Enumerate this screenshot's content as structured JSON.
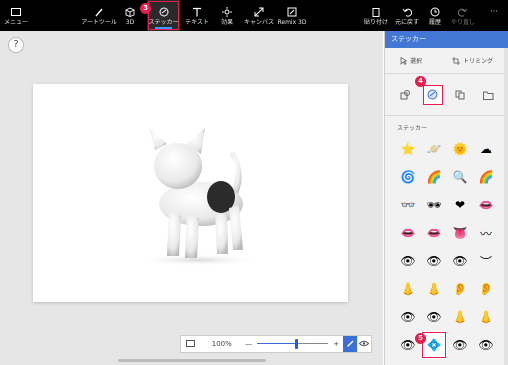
{
  "toolbar": {
    "menu": "メニュー",
    "items": [
      "アートツール",
      "3D",
      "ステッカー",
      "テキスト",
      "効果",
      "キャンバス",
      "Remix 3D"
    ],
    "right": [
      "貼り付け",
      "元に戻す",
      "履歴",
      "やり直し"
    ],
    "more": "···"
  },
  "callouts": {
    "c3": "3",
    "c4": "4",
    "c5": "5"
  },
  "help": "?",
  "zoom": {
    "level": "100%",
    "minus": "—",
    "plus": "+",
    "fraction": 0.55
  },
  "panel": {
    "title": "ステッカー",
    "select": "選択",
    "trim": "トリミング",
    "section": "ステッカー",
    "stickers": [
      [
        "⭐",
        "🪐",
        "🌞",
        "☁"
      ],
      [
        "🌀",
        "🌈",
        "🔍",
        "🌈"
      ],
      [
        "👓",
        "🕶",
        "❤",
        "👄"
      ],
      [
        "👄",
        "👄",
        "👅",
        "〰"
      ],
      [
        "👁",
        "👁",
        "👁",
        "︶"
      ],
      [
        "👃",
        "👃",
        "👂",
        "👂"
      ],
      [
        "👁",
        "👁",
        "👃",
        "👃"
      ],
      [
        "👁",
        "💠",
        "👁",
        "👁"
      ]
    ]
  },
  "colors": {
    "accent": "#4277d6",
    "highlight": "#e81c4f",
    "toolbar": "#000000"
  }
}
